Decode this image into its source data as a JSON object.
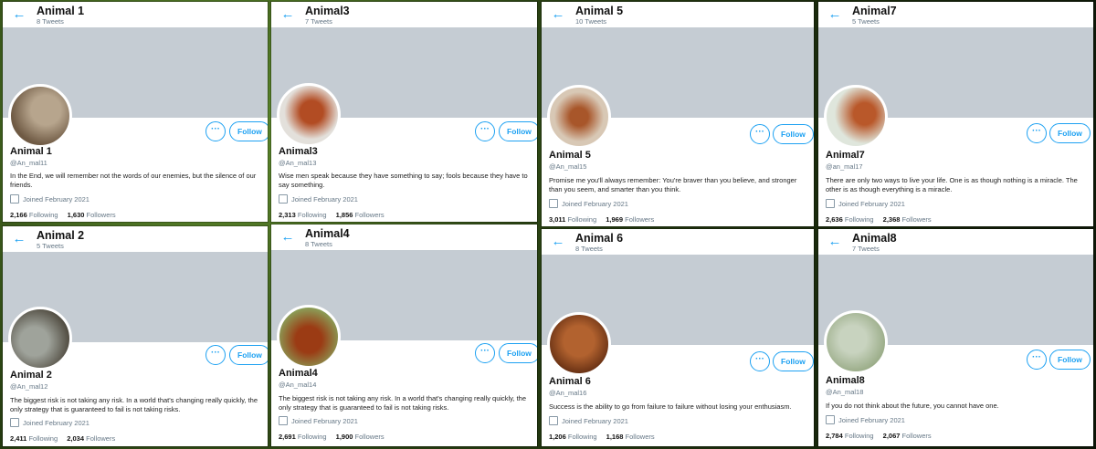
{
  "profiles": [
    {
      "top_name": "Animal 1",
      "tweets": "8 Tweets",
      "name": "Animal 1",
      "handle": "@An_mal11",
      "bio": "In the End, we will remember not the words of our enemies, but the silence of our friends.",
      "joined": "Joined February 2021",
      "following": "2,166",
      "following_label": "Following",
      "followers": "1,630",
      "followers_label": "Followers",
      "follow_label": "Follow",
      "more_label": "···",
      "avatar_colors": [
        "#b7a58d",
        "#6f5a44"
      ]
    },
    {
      "top_name": "Animal 2",
      "tweets": "5 Tweets",
      "name": "Animal 2",
      "handle": "@An_mal12",
      "bio": "The biggest risk is not taking any risk. In a world that's changing really quickly, the only strategy that is guaranteed to fail is not taking risks.",
      "joined": "Joined February 2021",
      "following": "2,411",
      "following_label": "Following",
      "followers": "2,034",
      "followers_label": "Followers",
      "follow_label": "Follow",
      "more_label": "···",
      "avatar_colors": [
        "#9fa39b",
        "#4f4a3f"
      ]
    },
    {
      "top_name": "Animal3",
      "tweets": "7 Tweets",
      "name": "Animal3",
      "handle": "@An_mal13",
      "bio": "Wise men speak because they have something to say; fools because they have to say something.",
      "joined": "Joined February 2021",
      "following": "2,313",
      "following_label": "Following",
      "followers": "1,856",
      "followers_label": "Followers",
      "follow_label": "Follow",
      "more_label": "···",
      "avatar_colors": [
        "#e3e0db",
        "#b24c23"
      ]
    },
    {
      "top_name": "Animal4",
      "tweets": "8 Tweets",
      "name": "Animal4",
      "handle": "@An_mal14",
      "bio": "The biggest risk is not taking any risk. In a world that's changing really quickly, the only strategy that is guaranteed to fail is not taking risks.",
      "joined": "Joined February 2021",
      "following": "2,691",
      "following_label": "Following",
      "followers": "1,900",
      "followers_label": "Followers",
      "follow_label": "Follow",
      "more_label": "···",
      "avatar_colors": [
        "#8aa25a",
        "#9b3b14"
      ]
    },
    {
      "top_name": "Animal 5",
      "tweets": "10 Tweets",
      "name": "Animal 5",
      "handle": "@An_mal15",
      "bio": "Promise me you'll always remember: You're braver than you believe, and stronger than you seem, and smarter than you think.",
      "joined": "Joined February 2021",
      "following": "3,011",
      "following_label": "Following",
      "followers": "1,969",
      "followers_label": "Followers",
      "follow_label": "Follow",
      "more_label": "···",
      "avatar_colors": [
        "#d8c8b5",
        "#a8562a"
      ]
    },
    {
      "top_name": "Animal 6",
      "tweets": "8 Tweets",
      "name": "Animal 6",
      "handle": "@An_mal16",
      "bio": "Success is the ability to go from failure to failure without losing your enthusiasm.",
      "joined": "Joined February 2021",
      "following": "1,206",
      "following_label": "Following",
      "followers": "1,168",
      "followers_label": "Followers",
      "follow_label": "Follow",
      "more_label": "···",
      "avatar_colors": [
        "#b2622f",
        "#5e2a10"
      ]
    },
    {
      "top_name": "Animal7",
      "tweets": "5 Tweets",
      "name": "Animal7",
      "handle": "@an_mal17",
      "bio": "There are only two ways to live your life. One is as though nothing is a miracle. The other is as though everything is a miracle.",
      "joined": "Joined February 2021",
      "following": "2,636",
      "following_label": "Following",
      "followers": "2,368",
      "followers_label": "Followers",
      "follow_label": "Follow",
      "more_label": "···",
      "avatar_colors": [
        "#dfe6dc",
        "#b9582a"
      ]
    },
    {
      "top_name": "Animal8",
      "tweets": "7 Tweets",
      "name": "Animal8",
      "handle": "@An_mal18",
      "bio": "If you do not think about the future, you cannot have one.",
      "joined": "Joined February 2021",
      "following": "2,784",
      "following_label": "Following",
      "followers": "2,067",
      "followers_label": "Followers",
      "follow_label": "Follow",
      "more_label": "···",
      "avatar_colors": [
        "#c8d3bf",
        "#8da178"
      ]
    }
  ]
}
